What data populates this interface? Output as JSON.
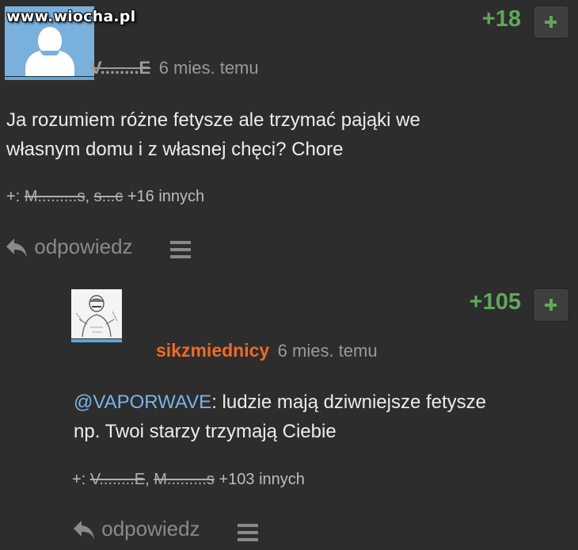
{
  "watermark": "www.wiocha.pl",
  "colors": {
    "score": "#5fa85a",
    "accent": "#5aa7e0",
    "username_highlight": "#ef6a27",
    "mention": "#7ab4e6"
  },
  "comments": [
    {
      "score": "+18",
      "user": "V........E",
      "time": "6 mies. temu",
      "text_lines": [
        "Ja rozumiem różne fetysze ale trzymać pająki we",
        "własnym domu i z własnej chęci? Chore"
      ],
      "plus_prefix": "+:",
      "plus_users": [
        "M.........s",
        "s...c"
      ],
      "plus_sep": ",",
      "plus_more": "+16 innych",
      "reply_label": "odpowiedz",
      "avatar_icon": "default-user-avatar",
      "vote_icon": "plus-icon",
      "reply_icon": "reply-arrow-icon",
      "menu_icon": "hamburger-menu-icon"
    },
    {
      "score": "+105",
      "user": "sikzmiednicy",
      "time": "6 mies. temu",
      "mention": "@VAPORWAVE",
      "text_rest": ": ludzie mają dziwniejsze fetysze",
      "text_line2": "np. Twoi starzy trzymają Ciebie",
      "plus_prefix": "+:",
      "plus_users": [
        "V........E",
        "M.........s"
      ],
      "plus_sep": ",",
      "plus_more": "+103 innych",
      "reply_label": "odpowiedz",
      "avatar_icon": "sketch-avatar",
      "vote_icon": "plus-icon",
      "reply_icon": "reply-arrow-icon",
      "menu_icon": "hamburger-menu-icon"
    }
  ]
}
